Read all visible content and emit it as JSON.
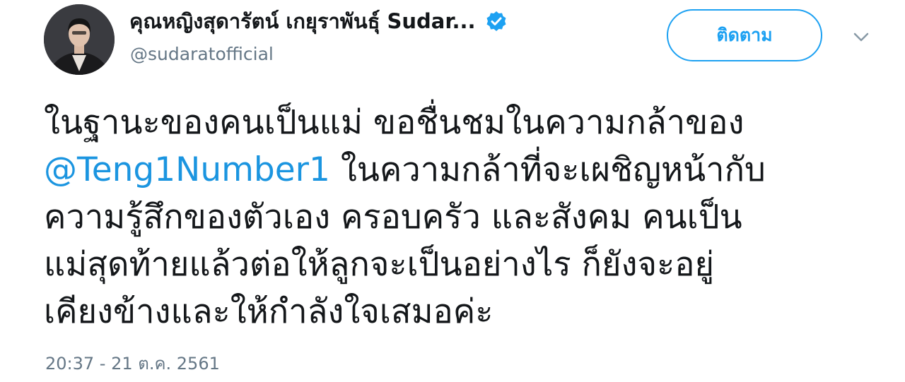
{
  "author": {
    "display_name": "คุณหญิงสุดารัตน์ เกยุราพันธุ์ Sudar...",
    "handle": "@sudaratofficial",
    "verified": true
  },
  "follow_button": {
    "label": "ติดตาม"
  },
  "tweet": {
    "line1": "ในฐานะของคนเป็นแม่ ขอชื่นชมในความกล้าของ",
    "mention": "@Teng1Number1",
    "line2_rest": " ในความกล้าที่จะเผชิญหน้ากับ",
    "line3": "ความรู้สึกของตัวเอง ครอบครัว และสังคม คนเป็น",
    "line4": "แม่สุดท้ายแล้วต่อให้ลูกจะเป็นอย่างไร ก็ยังจะอยู่",
    "line5": "เคียงข้างและให้กำลังใจเสมอค่ะ"
  },
  "timestamp": "20:37 - 21 ต.ค. 2561",
  "colors": {
    "accent": "#1da1f2",
    "mention": "#1b95e0",
    "secondary_text": "#657786",
    "primary_text": "#14171a"
  },
  "icons": {
    "verified": "verified-badge-icon",
    "menu": "chevron-down-icon",
    "avatar": "profile-photo"
  }
}
